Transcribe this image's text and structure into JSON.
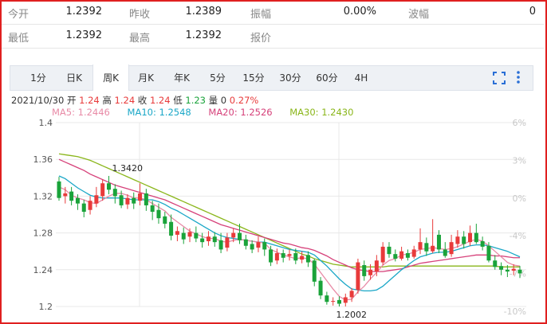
{
  "quote": {
    "row1": [
      {
        "label": "今开",
        "value": "1.2392"
      },
      {
        "label": "昨收",
        "value": "1.2389"
      },
      {
        "label": "振幅",
        "value": "0.00%"
      },
      {
        "label": "波幅",
        "value": "0"
      }
    ],
    "row2": [
      {
        "label": "最低",
        "value": "1.2392"
      },
      {
        "label": "最高",
        "value": "1.2392"
      },
      {
        "label": "报价",
        "value": ""
      }
    ]
  },
  "tabs": [
    "1分",
    "日K",
    "周K",
    "月K",
    "年K",
    "5分",
    "15分",
    "30分",
    "60分",
    "4H"
  ],
  "active_tab": "周K",
  "icons": {
    "fullscreen": "fullscreen-icon",
    "more": "more-vertical-icon"
  },
  "info": {
    "date": "2021/10/30",
    "open_label": "开",
    "open": "1.24",
    "high_label": "高",
    "high": "1.24",
    "close_label": "收",
    "close": "1.24",
    "low_label": "低",
    "low": "1.23",
    "volume_label": "量",
    "volume": "0",
    "change": "0.27%"
  },
  "ma_labels": [
    {
      "text": "MA5: 1.2446",
      "color": "#e88aa6"
    },
    {
      "text": "MA10: 1.2548",
      "color": "#1aa7c7"
    },
    {
      "text": "MA20: 1.2526",
      "color": "#d6417a"
    },
    {
      "text": "MA30: 1.2430",
      "color": "#8ab61a"
    }
  ],
  "colors": {
    "up": "#e83a3a",
    "down": "#1aa33a",
    "axis_right": "#c8c8c8",
    "grid": "#e8e8e8"
  },
  "chart_data": {
    "type": "candlestick",
    "ylim": [
      1.2,
      1.4
    ],
    "yticks": [
      "1.4",
      "1.36",
      "1.32",
      "1.28",
      "1.24",
      "1.2"
    ],
    "pct_ticks": [
      "6%",
      "3%",
      "0%",
      "-4%",
      "-7%",
      "-10%"
    ],
    "annotations": [
      {
        "text": "1.3420"
      },
      {
        "text": "1.2002"
      }
    ],
    "candles": [
      [
        1.336,
        1.318,
        1.341,
        1.315
      ],
      [
        1.32,
        1.323,
        1.33,
        1.312
      ],
      [
        1.325,
        1.315,
        1.33,
        1.31
      ],
      [
        1.318,
        1.312,
        1.322,
        1.305
      ],
      [
        1.312,
        1.303,
        1.316,
        1.297
      ],
      [
        1.305,
        1.315,
        1.32,
        1.3
      ],
      [
        1.312,
        1.321,
        1.33,
        1.308
      ],
      [
        1.32,
        1.334,
        1.338,
        1.315
      ],
      [
        1.334,
        1.327,
        1.342,
        1.322
      ],
      [
        1.328,
        1.32,
        1.333,
        1.312
      ],
      [
        1.321,
        1.31,
        1.326,
        1.307
      ],
      [
        1.311,
        1.318,
        1.322,
        1.306
      ],
      [
        1.318,
        1.312,
        1.324,
        1.306
      ],
      [
        1.315,
        1.323,
        1.334,
        1.31
      ],
      [
        1.323,
        1.31,
        1.328,
        1.304
      ],
      [
        1.31,
        1.303,
        1.315,
        1.294
      ],
      [
        1.305,
        1.296,
        1.312,
        1.29
      ],
      [
        1.298,
        1.29,
        1.303,
        1.285
      ],
      [
        1.292,
        1.277,
        1.3,
        1.272
      ],
      [
        1.278,
        1.282,
        1.287,
        1.271
      ],
      [
        1.28,
        1.273,
        1.286,
        1.268
      ],
      [
        1.276,
        1.281,
        1.285,
        1.27
      ],
      [
        1.28,
        1.274,
        1.287,
        1.27
      ],
      [
        1.274,
        1.27,
        1.28,
        1.264
      ],
      [
        1.271,
        1.276,
        1.282,
        1.266
      ],
      [
        1.276,
        1.27,
        1.281,
        1.265
      ],
      [
        1.272,
        1.262,
        1.28,
        1.258
      ],
      [
        1.264,
        1.275,
        1.28,
        1.26
      ],
      [
        1.275,
        1.28,
        1.285,
        1.27
      ],
      [
        1.28,
        1.272,
        1.29,
        1.268
      ],
      [
        1.273,
        1.266,
        1.278,
        1.262
      ],
      [
        1.268,
        1.262,
        1.272,
        1.258
      ],
      [
        1.264,
        1.27,
        1.276,
        1.259
      ],
      [
        1.27,
        1.262,
        1.274,
        1.255
      ],
      [
        1.262,
        1.248,
        1.266,
        1.244
      ],
      [
        1.25,
        1.258,
        1.263,
        1.246
      ],
      [
        1.258,
        1.253,
        1.262,
        1.248
      ],
      [
        1.255,
        1.257,
        1.262,
        1.25
      ],
      [
        1.258,
        1.25,
        1.263,
        1.246
      ],
      [
        1.251,
        1.255,
        1.26,
        1.247
      ],
      [
        1.256,
        1.248,
        1.26,
        1.243
      ],
      [
        1.25,
        1.227,
        1.252,
        1.222
      ],
      [
        1.228,
        1.212,
        1.232,
        1.208
      ],
      [
        1.212,
        1.205,
        1.216,
        1.202
      ],
      [
        1.206,
        1.206,
        1.21,
        1.201
      ],
      [
        1.207,
        1.203,
        1.211,
        1.2
      ],
      [
        1.204,
        1.21,
        1.214,
        1.2
      ],
      [
        1.21,
        1.217,
        1.22,
        1.205
      ],
      [
        1.218,
        1.248,
        1.252,
        1.214
      ],
      [
        1.245,
        1.233,
        1.25,
        1.228
      ],
      [
        1.234,
        1.24,
        1.246,
        1.229
      ],
      [
        1.238,
        1.25,
        1.256,
        1.233
      ],
      [
        1.248,
        1.265,
        1.27,
        1.245
      ],
      [
        1.265,
        1.257,
        1.27,
        1.253
      ],
      [
        1.257,
        1.252,
        1.262,
        1.249
      ],
      [
        1.252,
        1.26,
        1.265,
        1.25
      ],
      [
        1.258,
        1.253,
        1.262,
        1.25
      ],
      [
        1.254,
        1.262,
        1.266,
        1.252
      ],
      [
        1.262,
        1.27,
        1.285,
        1.257
      ],
      [
        1.269,
        1.26,
        1.275,
        1.255
      ],
      [
        1.26,
        1.266,
        1.295,
        1.258
      ],
      [
        1.278,
        1.262,
        1.283,
        1.258
      ],
      [
        1.262,
        1.255,
        1.27,
        1.253
      ],
      [
        1.257,
        1.27,
        1.278,
        1.254
      ],
      [
        1.268,
        1.276,
        1.283,
        1.264
      ],
      [
        1.276,
        1.268,
        1.282,
        1.263
      ],
      [
        1.27,
        1.28,
        1.288,
        1.266
      ],
      [
        1.28,
        1.27,
        1.29,
        1.268
      ],
      [
        1.271,
        1.265,
        1.276,
        1.261
      ],
      [
        1.266,
        1.25,
        1.27,
        1.248
      ],
      [
        1.25,
        1.243,
        1.256,
        1.24
      ],
      [
        1.244,
        1.24,
        1.248,
        1.234
      ],
      [
        1.24,
        1.238,
        1.245,
        1.232
      ],
      [
        1.239,
        1.241,
        1.246,
        1.234
      ],
      [
        1.24,
        1.236,
        1.244,
        1.231
      ]
    ],
    "ma": {
      "MA5": [
        1.33,
        1.327,
        1.321,
        1.318,
        1.316,
        1.313,
        1.312,
        1.316,
        1.32,
        1.323,
        1.323,
        1.321,
        1.318,
        1.318,
        1.316,
        1.312,
        1.308,
        1.304,
        1.297,
        1.292,
        1.287,
        1.282,
        1.279,
        1.276,
        1.274,
        1.274,
        1.271,
        1.27,
        1.272,
        1.273,
        1.272,
        1.271,
        1.27,
        1.269,
        1.262,
        1.259,
        1.256,
        1.254,
        1.252,
        1.253,
        1.252,
        1.246,
        1.237,
        1.228,
        1.219,
        1.211,
        1.207,
        1.208,
        1.216,
        1.222,
        1.23,
        1.237,
        1.245,
        1.25,
        1.252,
        1.256,
        1.257,
        1.259,
        1.262,
        1.263,
        1.264,
        1.263,
        1.262,
        1.263,
        1.265,
        1.268,
        1.271,
        1.273,
        1.271,
        1.266,
        1.26,
        1.254,
        1.248,
        1.245,
        1.244
      ],
      "MA10": [
        1.342,
        1.339,
        1.334,
        1.329,
        1.325,
        1.321,
        1.319,
        1.318,
        1.318,
        1.318,
        1.318,
        1.317,
        1.316,
        1.316,
        1.316,
        1.316,
        1.314,
        1.311,
        1.307,
        1.304,
        1.3,
        1.296,
        1.292,
        1.288,
        1.284,
        1.28,
        1.277,
        1.275,
        1.274,
        1.273,
        1.272,
        1.271,
        1.27,
        1.27,
        1.268,
        1.266,
        1.264,
        1.262,
        1.261,
        1.26,
        1.259,
        1.256,
        1.25,
        1.244,
        1.237,
        1.23,
        1.224,
        1.219,
        1.218,
        1.217,
        1.217,
        1.218,
        1.222,
        1.228,
        1.234,
        1.24,
        1.245,
        1.25,
        1.254,
        1.256,
        1.258,
        1.259,
        1.259,
        1.26,
        1.262,
        1.264,
        1.266,
        1.267,
        1.267,
        1.266,
        1.264,
        1.262,
        1.26,
        1.257,
        1.254
      ],
      "MA20": [
        1.36,
        1.357,
        1.354,
        1.351,
        1.348,
        1.344,
        1.341,
        1.338,
        1.335,
        1.332,
        1.33,
        1.328,
        1.326,
        1.324,
        1.322,
        1.32,
        1.318,
        1.316,
        1.313,
        1.31,
        1.307,
        1.304,
        1.301,
        1.298,
        1.295,
        1.292,
        1.289,
        1.287,
        1.285,
        1.283,
        1.281,
        1.279,
        1.277,
        1.275,
        1.273,
        1.271,
        1.269,
        1.268,
        1.266,
        1.264,
        1.263,
        1.261,
        1.258,
        1.255,
        1.251,
        1.248,
        1.245,
        1.242,
        1.24,
        1.239,
        1.238,
        1.238,
        1.238,
        1.239,
        1.24,
        1.241,
        1.243,
        1.245,
        1.247,
        1.248,
        1.249,
        1.25,
        1.251,
        1.252,
        1.253,
        1.254,
        1.255,
        1.256,
        1.256,
        1.256,
        1.255,
        1.255,
        1.254,
        1.253,
        1.253
      ],
      "MA30": [
        1.366,
        1.365,
        1.364,
        1.363,
        1.361,
        1.359,
        1.356,
        1.353,
        1.35,
        1.347,
        1.344,
        1.341,
        1.338,
        1.335,
        1.332,
        1.329,
        1.326,
        1.323,
        1.32,
        1.317,
        1.314,
        1.311,
        1.308,
        1.305,
        1.302,
        1.299,
        1.296,
        1.293,
        1.29,
        1.287,
        1.284,
        1.281,
        1.278,
        1.275,
        1.272,
        1.269,
        1.266,
        1.263,
        1.26,
        1.257,
        1.255,
        1.252,
        1.25,
        1.248,
        1.246,
        1.245,
        1.244,
        1.243,
        1.243,
        1.243,
        1.243,
        1.243,
        1.243,
        1.244,
        1.244,
        1.244,
        1.244,
        1.244,
        1.244,
        1.244,
        1.244,
        1.244,
        1.244,
        1.244,
        1.244,
        1.244,
        1.244,
        1.244,
        1.244,
        1.244,
        1.244,
        1.243,
        1.243,
        1.243,
        1.243
      ]
    }
  }
}
